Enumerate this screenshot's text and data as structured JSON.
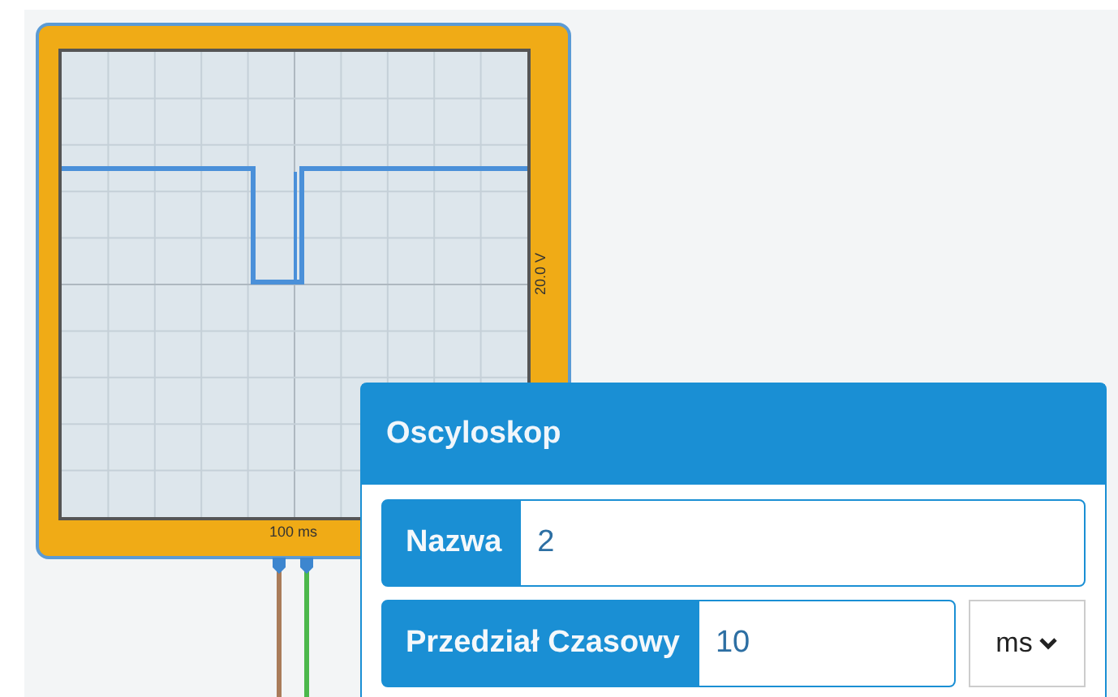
{
  "oscilloscope": {
    "voltage_scale": "20.0 V",
    "time_scale": "100 ms"
  },
  "panel": {
    "title": "Oscyloskop",
    "fields": [
      {
        "kind": "text",
        "label": "Nazwa",
        "value": "2"
      },
      {
        "kind": "unit",
        "label": "Przedział Czasowy",
        "value": "10",
        "unit": "ms"
      }
    ]
  }
}
